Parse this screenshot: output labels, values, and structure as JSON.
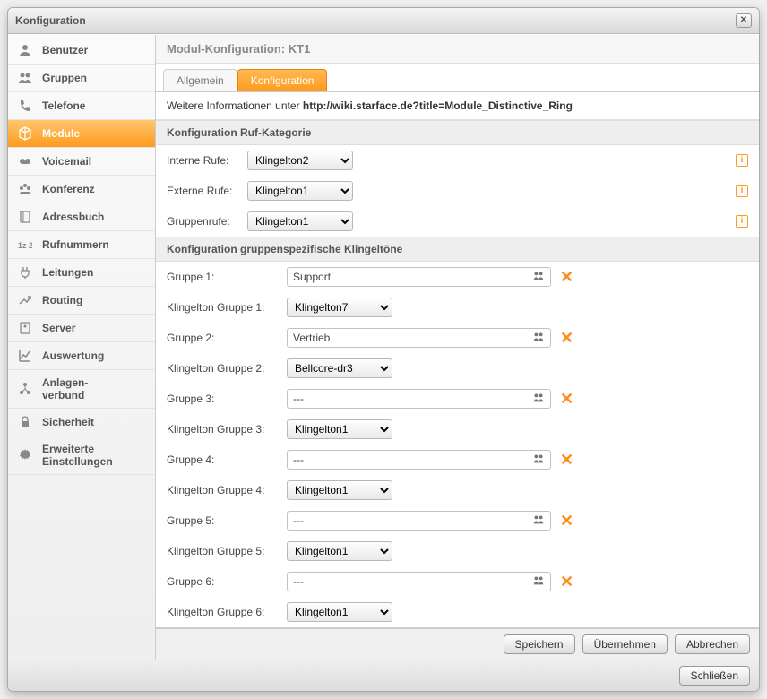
{
  "window": {
    "title": "Konfiguration"
  },
  "sidebar": {
    "items": [
      {
        "label": "Benutzer",
        "icon": "user"
      },
      {
        "label": "Gruppen",
        "icon": "users"
      },
      {
        "label": "Telefone",
        "icon": "phone"
      },
      {
        "label": "Module",
        "icon": "cube",
        "active": true
      },
      {
        "label": "Voicemail",
        "icon": "tape"
      },
      {
        "label": "Konferenz",
        "icon": "conf"
      },
      {
        "label": "Adressbuch",
        "icon": "book"
      },
      {
        "label": "Rufnummern",
        "icon": "numbers"
      },
      {
        "label": "Leitungen",
        "icon": "plug"
      },
      {
        "label": "Routing",
        "icon": "routing"
      },
      {
        "label": "Server",
        "icon": "server"
      },
      {
        "label": "Auswertung",
        "icon": "chart"
      },
      {
        "label": "Anlagen-\nverbund",
        "icon": "cluster"
      },
      {
        "label": "Sicherheit",
        "icon": "lock"
      },
      {
        "label": "Erweiterte\nEinstellungen",
        "icon": "gear"
      }
    ]
  },
  "header": {
    "prefix": "Modul-Konfiguration:",
    "name": "KT1"
  },
  "tabs": [
    {
      "label": "Allgemein",
      "active": false
    },
    {
      "label": "Konfiguration",
      "active": true
    }
  ],
  "info": {
    "text": "Weitere Informationen unter ",
    "link": "http://wiki.starface.de?title=Module_Distinctive_Ring"
  },
  "section1": {
    "title": "Konfiguration Ruf-Kategorie"
  },
  "rufkat": {
    "interne_label": "Interne Rufe:",
    "interne_value": "Klingelton2",
    "externe_label": "Externe Rufe:",
    "externe_value": "Klingelton1",
    "gruppen_label": "Gruppenrufe:",
    "gruppen_value": "Klingelton1"
  },
  "section2": {
    "title": "Konfiguration gruppenspezifische Klingeltöne"
  },
  "group_rows": [
    {
      "g_label": "Gruppe 1:",
      "g_value": "Support",
      "k_label": "Klingelton Gruppe 1:",
      "k_value": "Klingelton7"
    },
    {
      "g_label": "Gruppe 2:",
      "g_value": "Vertrieb",
      "k_label": "Klingelton Gruppe 2:",
      "k_value": "Bellcore-dr3"
    },
    {
      "g_label": "Gruppe 3:",
      "g_value": "---",
      "k_label": "Klingelton Gruppe 3:",
      "k_value": "Klingelton1"
    },
    {
      "g_label": "Gruppe 4:",
      "g_value": "---",
      "k_label": "Klingelton Gruppe 4:",
      "k_value": "Klingelton1"
    },
    {
      "g_label": "Gruppe 5:",
      "g_value": "---",
      "k_label": "Klingelton Gruppe 5:",
      "k_value": "Klingelton1"
    },
    {
      "g_label": "Gruppe 6:",
      "g_value": "---",
      "k_label": "Klingelton Gruppe 6:",
      "k_value": "Klingelton1"
    }
  ],
  "buttons": {
    "save": "Speichern",
    "apply": "Übernehmen",
    "cancel": "Abbrechen",
    "close": "Schließen"
  }
}
